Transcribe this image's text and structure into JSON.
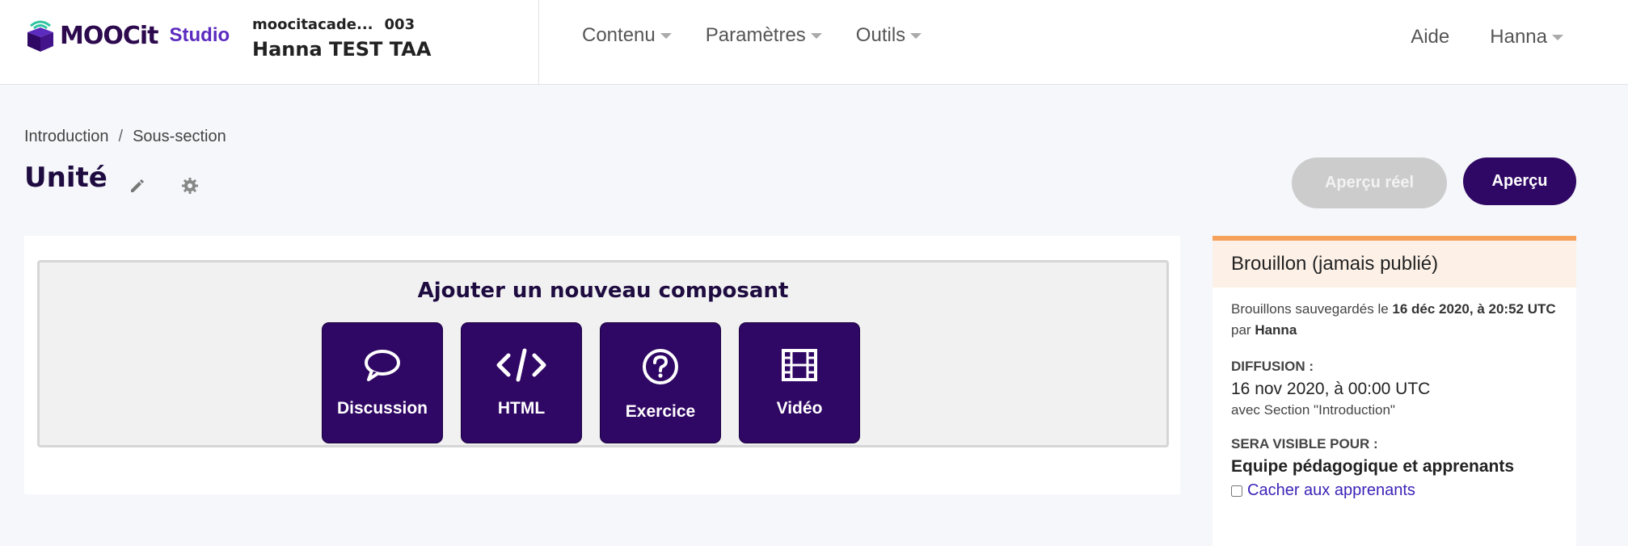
{
  "brand": {
    "name": "MOOCit",
    "studio": "Studio"
  },
  "course": {
    "org": "moocitacade...",
    "number": "003",
    "title": "Hanna TEST TAA"
  },
  "nav": [
    {
      "label": "Contenu"
    },
    {
      "label": "Paramètres"
    },
    {
      "label": "Outils"
    }
  ],
  "user_nav": {
    "help": "Aide",
    "user": "Hanna"
  },
  "breadcrumb": [
    "Introduction",
    "Sous-section"
  ],
  "breadcrumb_sep": "/",
  "page_title": "Unité",
  "actions": {
    "live_preview": "Aperçu réel",
    "preview": "Aperçu"
  },
  "add_component": {
    "title": "Ajouter un nouveau composant",
    "buttons": [
      {
        "label": "Discussion",
        "icon": "discussion-icon"
      },
      {
        "label": "HTML",
        "icon": "code-icon"
      },
      {
        "label": "Exercice",
        "icon": "question-icon"
      },
      {
        "label": "Vidéo",
        "icon": "video-icon"
      }
    ]
  },
  "status": {
    "title": "Brouillon (jamais publié)",
    "draft_prefix": "Brouillons sauvegardés le",
    "draft_date": "16 déc 2020, à 20:52 UTC",
    "draft_by": "par",
    "draft_user": "Hanna",
    "release_label": "DIFFUSION :",
    "release_date": "16 nov 2020, à 00:00 UTC",
    "release_with": "avec Section \"Introduction\"",
    "visible_label": "SERA VISIBLE POUR :",
    "visible_value": "Equipe pédagogique et apprenants",
    "hide_label": "Cacher aux apprenants",
    "hide_checked": false
  },
  "colors": {
    "brand": "#2f0764",
    "accent": "#5b2bbf",
    "status_bar": "#f6a25c"
  }
}
